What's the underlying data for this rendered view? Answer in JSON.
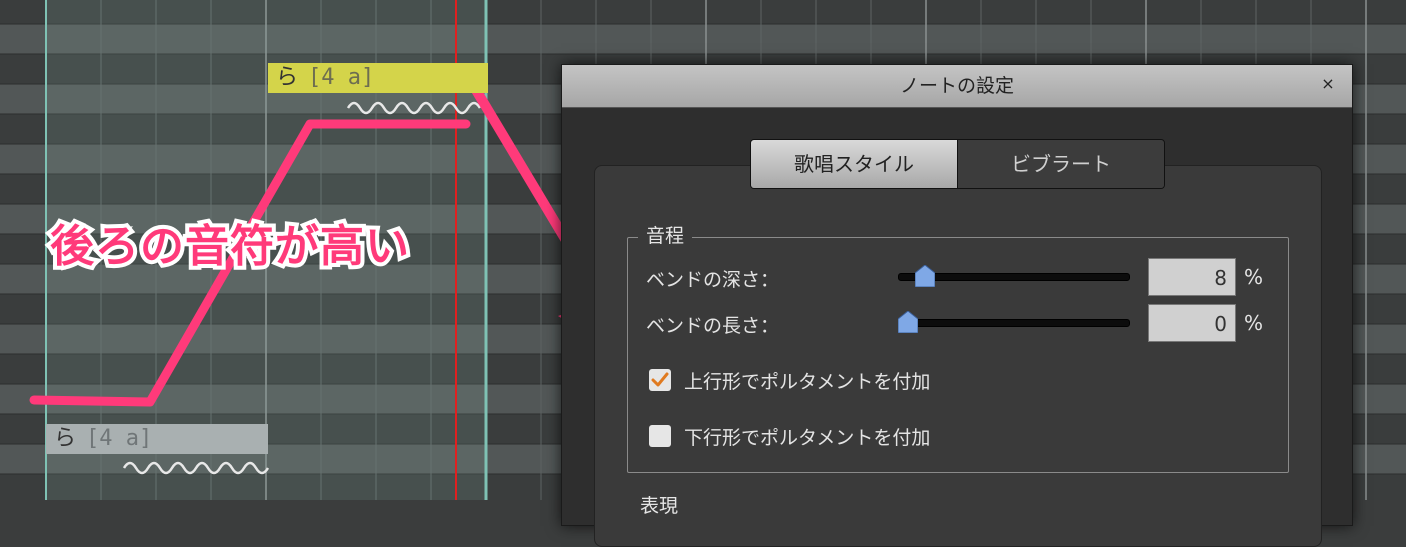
{
  "notes": {
    "upper": {
      "lyric": "ら",
      "phoneme": "[4 a]"
    },
    "lower": {
      "lyric": "ら",
      "phoneme": "[4 a]"
    }
  },
  "annotation": {
    "caption": "後ろの音符が高い",
    "color": "#ff3a7a"
  },
  "dialog": {
    "title": "ノートの設定",
    "close_label": "×",
    "tabs": [
      {
        "label": "歌唱スタイル",
        "active": true
      },
      {
        "label": "ビブラート",
        "active": false
      }
    ],
    "group_label": "音程",
    "bend_depth": {
      "label": "ベンドの深さ：",
      "value": "8",
      "unit": "%",
      "level": 0.08
    },
    "bend_length": {
      "label": "ベンドの長さ：",
      "value": "0",
      "unit": "%",
      "level": 0.0
    },
    "portamento_up": {
      "label": "上行形でポルタメントを付加",
      "checked": true
    },
    "portamento_down": {
      "label": "下行形でポルタメントを付加",
      "checked": false
    },
    "next_group_label": "表現"
  },
  "colors": {
    "playhead": "#e02020",
    "note_selected": "#d4d44a",
    "note_normal": "#a9b0b1"
  }
}
